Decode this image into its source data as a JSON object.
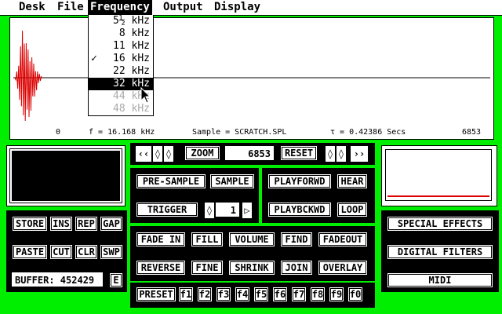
{
  "menubar": {
    "items": [
      "Desk",
      "File",
      "Frequency",
      "Output",
      "Display"
    ],
    "active": "Frequency"
  },
  "frequency_menu": {
    "items": [
      {
        "label": "5½ kHz",
        "checked": false,
        "selected": false,
        "disabled": false
      },
      {
        "label": "8 kHz",
        "checked": false,
        "selected": false,
        "disabled": false
      },
      {
        "label": "11 kHz",
        "checked": false,
        "selected": false,
        "disabled": false
      },
      {
        "label": "16 kHz",
        "checked": true,
        "selected": false,
        "disabled": false
      },
      {
        "label": "22 kHz",
        "checked": false,
        "selected": false,
        "disabled": false
      },
      {
        "label": "32 kHz",
        "checked": false,
        "selected": true,
        "disabled": false
      },
      {
        "label": "44 kHz",
        "checked": false,
        "selected": false,
        "disabled": true
      },
      {
        "label": "48 kHz",
        "checked": false,
        "selected": false,
        "disabled": true
      }
    ],
    "check_glyph": "✓"
  },
  "waveform": {
    "start_sample": "0",
    "frequency": "f = 16.168 kHz",
    "sample_name": "Sample = SCRATCH.SPL",
    "duration": "τ = 0.42386 Secs",
    "end_sample": "6853",
    "colors": {
      "wave": "#dd0000",
      "axis": "#000000"
    }
  },
  "zoom_bar": {
    "left_fast": "‹‹",
    "left_step": "◊",
    "right_step": "◊",
    "zoom_label": "ZOOM",
    "zoom_value": "6853",
    "reset_label": "RESET",
    "reset_left": "◊",
    "reset_right": "◊",
    "right_fast": "››"
  },
  "sample_panel": {
    "pre_sample": "PRE-SAMPLE",
    "sample": "SAMPLE",
    "trigger": "TRIGGER",
    "trigger_value": "1",
    "dec": "◊",
    "inc": "▷"
  },
  "play_panel": {
    "playforwd": "PLAYFORWD",
    "hear": "HEAR",
    "playbckwd": "PLAYBCKWD",
    "loop": "LOOP"
  },
  "edit_panel": {
    "store": "STORE",
    "ins": "INS",
    "rep": "REP",
    "gap": "GAP",
    "paste": "PASTE",
    "cut": "CUT",
    "clr": "CLR",
    "swp": "SWP",
    "buffer": "BUFFER:  452429",
    "e": "E"
  },
  "effects_panel": {
    "row1": [
      "FADE IN",
      "FILL",
      "VOLUME",
      "FIND",
      "FADEOUT"
    ],
    "row2": [
      "REVERSE",
      "FINE",
      "SHRINK",
      "JOIN",
      "OVERLAY"
    ]
  },
  "preset_bar": {
    "preset": "PRESET",
    "keys": [
      "f1",
      "f2",
      "f3",
      "f4",
      "f5",
      "f6",
      "f7",
      "f8",
      "f9",
      "f0"
    ]
  },
  "special_panel": {
    "special_effects": "SPECIAL   EFFECTS",
    "digital_filters": "DIGITAL   FILTERS",
    "midi": "MIDI"
  },
  "colors": {
    "desktop": "#00ee00",
    "level_line": "#dd0000"
  }
}
